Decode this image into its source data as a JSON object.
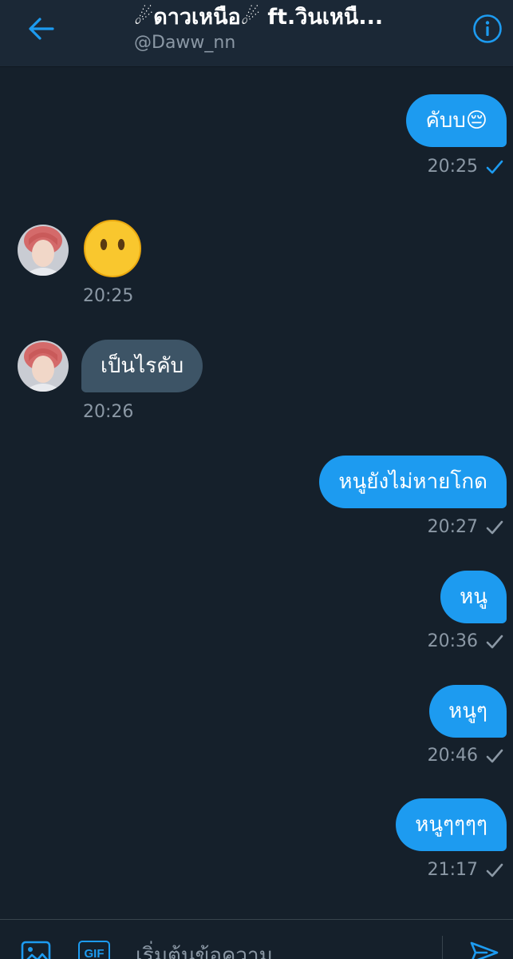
{
  "header": {
    "title": "☄ดาวเหนือ☄ ft.วินเหนื...",
    "handle": "@Daww_nn",
    "back_icon": "back-arrow-icon",
    "info_icon": "info-icon"
  },
  "messages": [
    {
      "direction": "sent",
      "text": "คับบ😔",
      "time": "20:25",
      "status": "read"
    },
    {
      "direction": "received",
      "text": "😶",
      "time": "20:25"
    },
    {
      "direction": "received",
      "text": "เป็นไรคับ",
      "time": "20:26"
    },
    {
      "direction": "sent",
      "text": "หนูยังไม่หายโกด",
      "time": "20:27",
      "status": "sent"
    },
    {
      "direction": "sent",
      "text": "หนู",
      "time": "20:36",
      "status": "sent"
    },
    {
      "direction": "sent",
      "text": "หนูๆ",
      "time": "20:46",
      "status": "sent"
    },
    {
      "direction": "sent",
      "text": "หนูๆๆๆๆ",
      "time": "21:17",
      "status": "sent"
    }
  ],
  "composer": {
    "placeholder": "เริ่มต้นข้อความ",
    "image_icon": "image-icon",
    "gif_label": "GIF",
    "send_icon": "send-icon"
  },
  "colors": {
    "background": "#15202b",
    "header": "#1b2836",
    "accent": "#1d9bf0",
    "received_bubble": "#3d5466",
    "muted_text": "#8b98a5"
  }
}
